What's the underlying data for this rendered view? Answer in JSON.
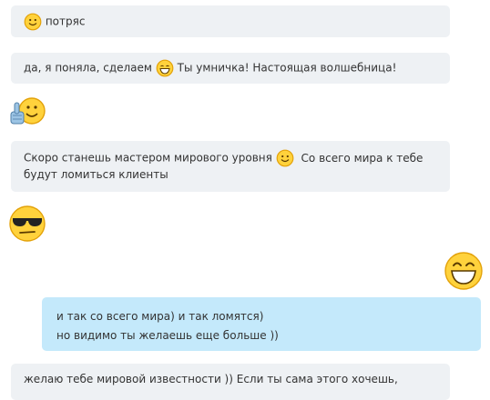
{
  "messages": [
    {
      "id": "m1",
      "direction": "incoming",
      "parts": [
        "потряс"
      ]
    },
    {
      "id": "m2",
      "direction": "incoming",
      "parts": [
        "да, я поняла, сделаем",
        "Ты умничка! Настоящая волшебница!"
      ]
    },
    {
      "id": "m3",
      "direction": "incoming",
      "type": "emoticon",
      "emoticon": "thumbs-up-smiley-icon"
    },
    {
      "id": "m4",
      "direction": "incoming",
      "line1": [
        "Скоро станешь мастером мирового уровня",
        "Со всего мира к тебе"
      ],
      "line2": "будут ломиться клиенты"
    },
    {
      "id": "m5",
      "direction": "incoming",
      "type": "emoticon",
      "emoticon": "sunglasses-smiley-icon"
    },
    {
      "id": "m6",
      "direction": "outgoing",
      "type": "emoticon",
      "emoticon": "big-grin-smiley-icon"
    },
    {
      "id": "m7",
      "direction": "outgoing",
      "lines": [
        "и так со всего мира) и так ломятся)",
        "но видимо ты желаешь еще больше ))"
      ]
    },
    {
      "id": "m8",
      "direction": "incoming",
      "lines": [
        "желаю тебе мировой известности )) Если ты сама этого хочешь,"
      ]
    }
  ],
  "colors": {
    "incoming_bubble": "#eef1f4",
    "outgoing_bubble": "#c4e9fb",
    "text": "#333333",
    "emoji_yellow": "#ffd23c",
    "emoji_outline": "#e3a20a"
  }
}
